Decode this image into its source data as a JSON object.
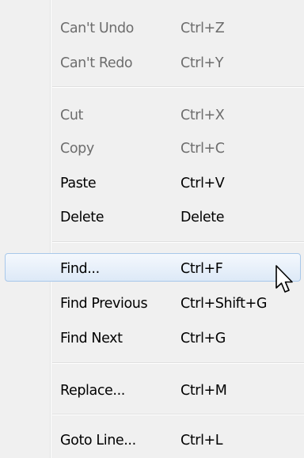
{
  "menu": {
    "items": [
      {
        "label": "Can't Undo",
        "shortcut": "Ctrl+Z"
      },
      {
        "label": "Can't Redo",
        "shortcut": "Ctrl+Y"
      },
      {
        "label": "Cut",
        "shortcut": "Ctrl+X"
      },
      {
        "label": "Copy",
        "shortcut": "Ctrl+C"
      },
      {
        "label": "Paste",
        "shortcut": "Ctrl+V"
      },
      {
        "label": "Delete",
        "shortcut": "Delete"
      },
      {
        "label": "Find...",
        "shortcut": "Ctrl+F"
      },
      {
        "label": "Find Previous",
        "shortcut": "Ctrl+Shift+G"
      },
      {
        "label": "Find Next",
        "shortcut": "Ctrl+G"
      },
      {
        "label": "Replace...",
        "shortcut": "Ctrl+M"
      },
      {
        "label": "Goto Line...",
        "shortcut": "Ctrl+L"
      }
    ],
    "disabled_items": [
      "Can't Undo",
      "Can't Redo",
      "Cut",
      "Copy"
    ],
    "highlighted_item": "Find..."
  },
  "colors": {
    "menu_background": "#f0f0f0",
    "disabled_text": "#6d6d6d",
    "highlight_border": "#a8c8ea"
  }
}
